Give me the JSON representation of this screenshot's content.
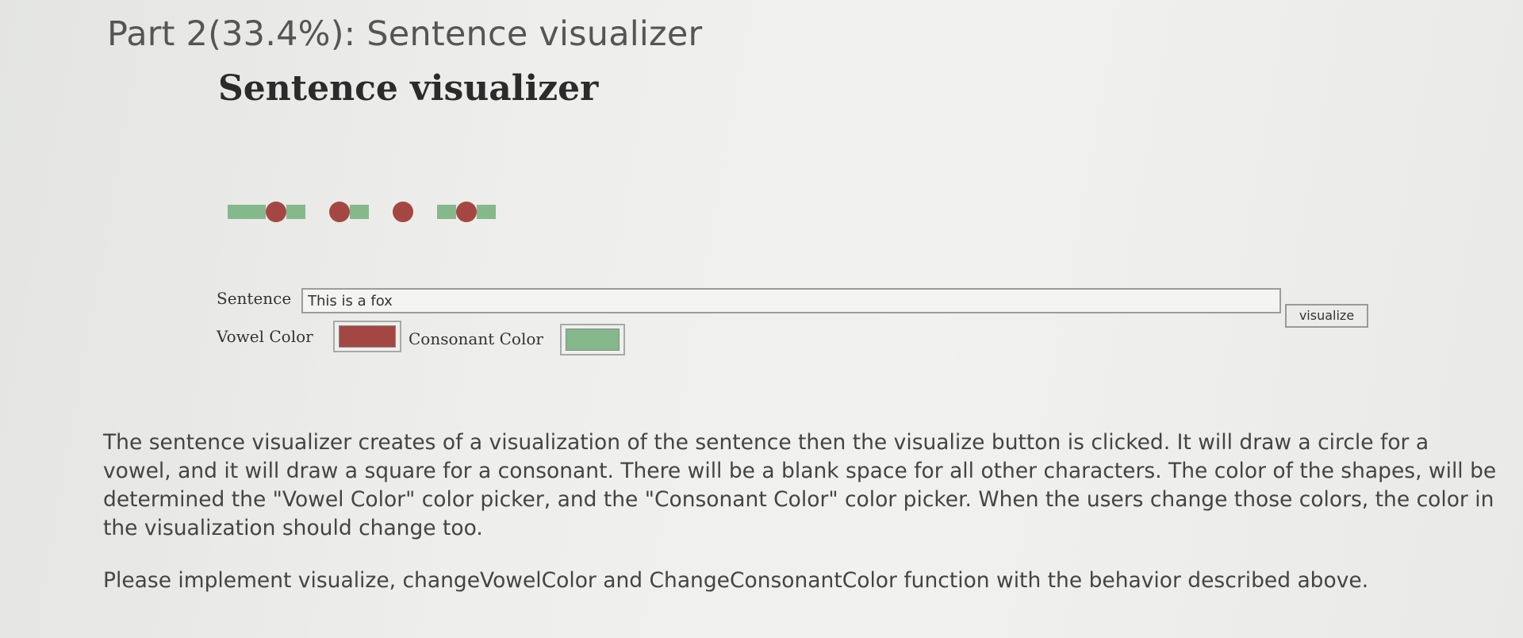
{
  "page": {
    "part_title": "Part 2(33.4%): Sentence visualizer",
    "heading": "Sentence visualizer"
  },
  "visualization": {
    "shapes": [
      "square",
      "square",
      "circle",
      "square",
      "blank",
      "circle",
      "square",
      "blank",
      "circle",
      "blank",
      "square",
      "circle",
      "square"
    ],
    "vowel_color": "#a44742",
    "consonant_color": "#85b98c"
  },
  "form": {
    "sentence_label": "Sentence",
    "sentence_value": "This is a fox",
    "visualize_label": "visualize",
    "vowel_label": "Vowel Color",
    "consonant_label": "Consonant Color"
  },
  "description": {
    "paragraph1": "The sentence visualizer creates of a visualization of the sentence then the visualize button is clicked.  It will draw a circle for a vowel, and it will draw a square for a consonant.  There will be a blank space for all other characters.  The color of the shapes, will be determined the \"Vowel Color\" color picker, and the \"Consonant Color\" color picker.  When the users change those colors, the color in the visualization should change too.",
    "paragraph2": "Please implement visualize, changeVowelColor and ChangeConsonantColor function with the behavior described above."
  }
}
